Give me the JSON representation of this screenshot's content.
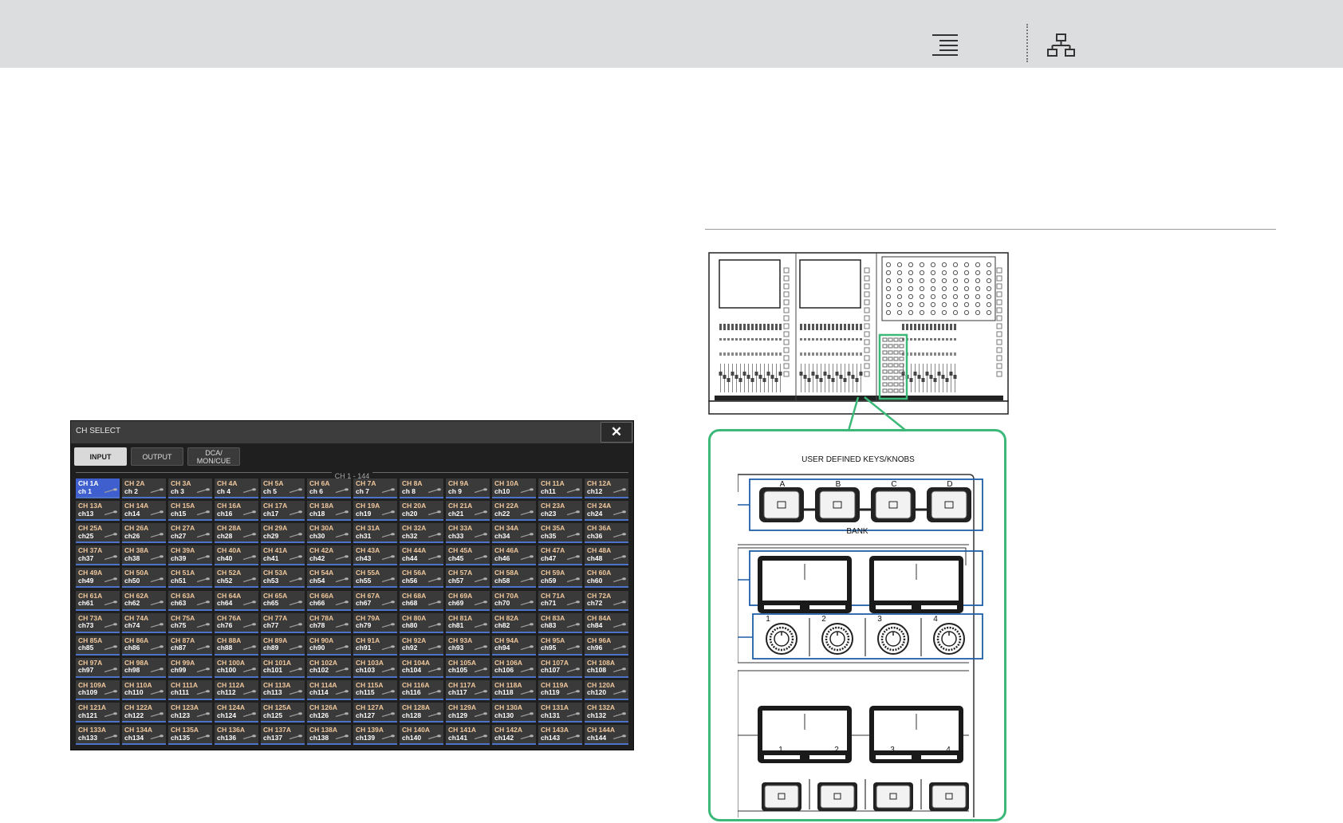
{
  "toolbar": {
    "icons": [
      "menu-lines-icon",
      "sitemap-icon"
    ]
  },
  "ch_select": {
    "title": "CH SELECT",
    "close_label": "✕",
    "tabs": [
      {
        "label": "INPUT",
        "active": true
      },
      {
        "label": "OUTPUT",
        "active": false
      },
      {
        "label": "DCA/\nMON/CUE",
        "active": false
      }
    ],
    "range_label": "CH 1 - 144",
    "selected_channel": "CH 1A"
  },
  "panel": {
    "title": "USER DEFINED KEYS/KNOBS",
    "bank_keys": [
      "A",
      "B",
      "C",
      "D"
    ],
    "bank_label": "BANK",
    "knob_labels": [
      "1",
      "2",
      "3",
      "4"
    ],
    "key_labels": [
      "1",
      "2",
      "3",
      "4"
    ]
  },
  "colors": {
    "highlight_green": "#3cb878",
    "highlight_blue": "#1f5fa8",
    "selected_channel": "#3f5fcf"
  }
}
